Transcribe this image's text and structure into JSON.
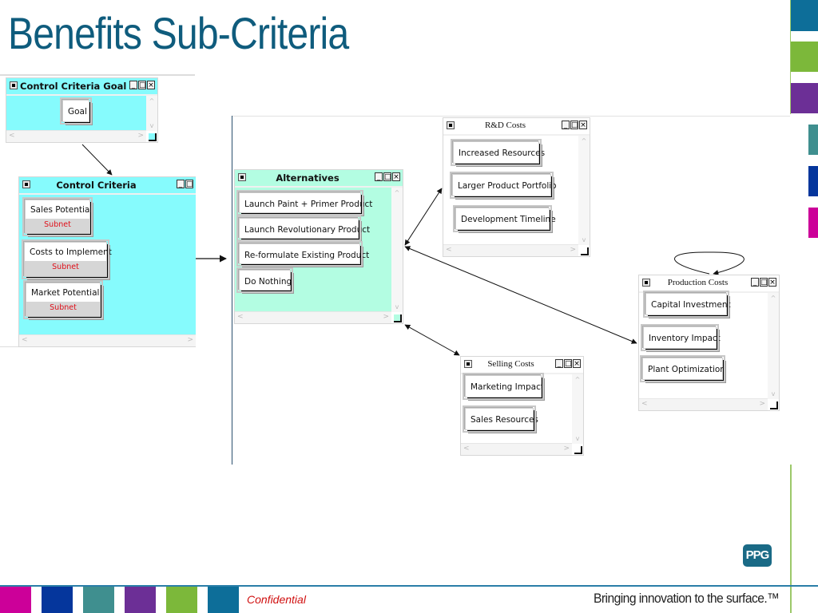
{
  "slide": {
    "title": "Benefits Sub-Criteria",
    "confidential_label": "Confidential",
    "tagline": "Bringing innovation to the surface.™",
    "logo_text": "PPG",
    "colors": {
      "title": "#0f5c7d",
      "brand_blue": "#0d6e99",
      "green": "#7cb83a",
      "purple": "#6c2f96",
      "teal": "#3f8f8f",
      "navy": "#05369c",
      "magenta": "#cc0099",
      "confidential": "#d01010"
    },
    "right_color_bars": [
      "brand_blue",
      "green",
      "purple",
      "teal",
      "navy",
      "magenta"
    ],
    "bottom_color_bars": [
      "magenta",
      "navy",
      "teal",
      "purple",
      "green",
      "brand_blue"
    ]
  },
  "windows": {
    "control_goal": {
      "title": "Control Criteria Goal",
      "bg": "#86fbfd",
      "nodes": [
        {
          "label": "Goal"
        }
      ]
    },
    "control_criteria": {
      "title": "Control Criteria",
      "bg": "#86fbfd",
      "nodes": [
        {
          "label": "Sales Potential",
          "sub": "Subnet"
        },
        {
          "label": "Costs to Implement",
          "sub": "Subnet"
        },
        {
          "label": "Market Potential",
          "sub": "Subnet"
        }
      ]
    },
    "alternatives": {
      "title": "Alternatives",
      "bg": "#b3fde2",
      "nodes": [
        {
          "label": "Launch Paint + Primer Product"
        },
        {
          "label": "Launch Revolutionary Product"
        },
        {
          "label": "Re-formulate Existing Product"
        },
        {
          "label": "Do Nothing"
        }
      ]
    },
    "rd_costs": {
      "title": "R&D Costs",
      "bg": "#ffffff",
      "nodes": [
        {
          "label": "Increased Resources"
        },
        {
          "label": "Larger Product Portfolio"
        },
        {
          "label": "Development Timeline"
        }
      ]
    },
    "production_costs": {
      "title": "Production Costs",
      "bg": "#ffffff",
      "nodes": [
        {
          "label": "Capital Investment"
        },
        {
          "label": "Inventory Impact"
        },
        {
          "label": "Plant Optimization"
        }
      ]
    },
    "selling_costs": {
      "title": "Selling Costs",
      "bg": "#ffffff",
      "nodes": [
        {
          "label": "Marketing Impact"
        },
        {
          "label": "Sales Resources"
        }
      ]
    }
  },
  "window_controls": {
    "system": "■",
    "minimize": "_",
    "maximize": "□",
    "close": "×"
  },
  "scroll_glyphs": {
    "up": "^",
    "down": "v",
    "left": "<",
    "right": ">"
  },
  "connections": [
    {
      "from": "control_goal",
      "to": "control_criteria",
      "type": "one-way"
    },
    {
      "from": "control_criteria",
      "to": "alternatives",
      "type": "one-way"
    },
    {
      "from": "alternatives",
      "to": "rd_costs",
      "type": "two-way"
    },
    {
      "from": "alternatives",
      "to": "production_costs",
      "type": "two-way"
    },
    {
      "from": "alternatives",
      "to": "selling_costs",
      "type": "two-way"
    },
    {
      "from": "production_costs",
      "to": "production_costs",
      "type": "self-loop"
    }
  ]
}
